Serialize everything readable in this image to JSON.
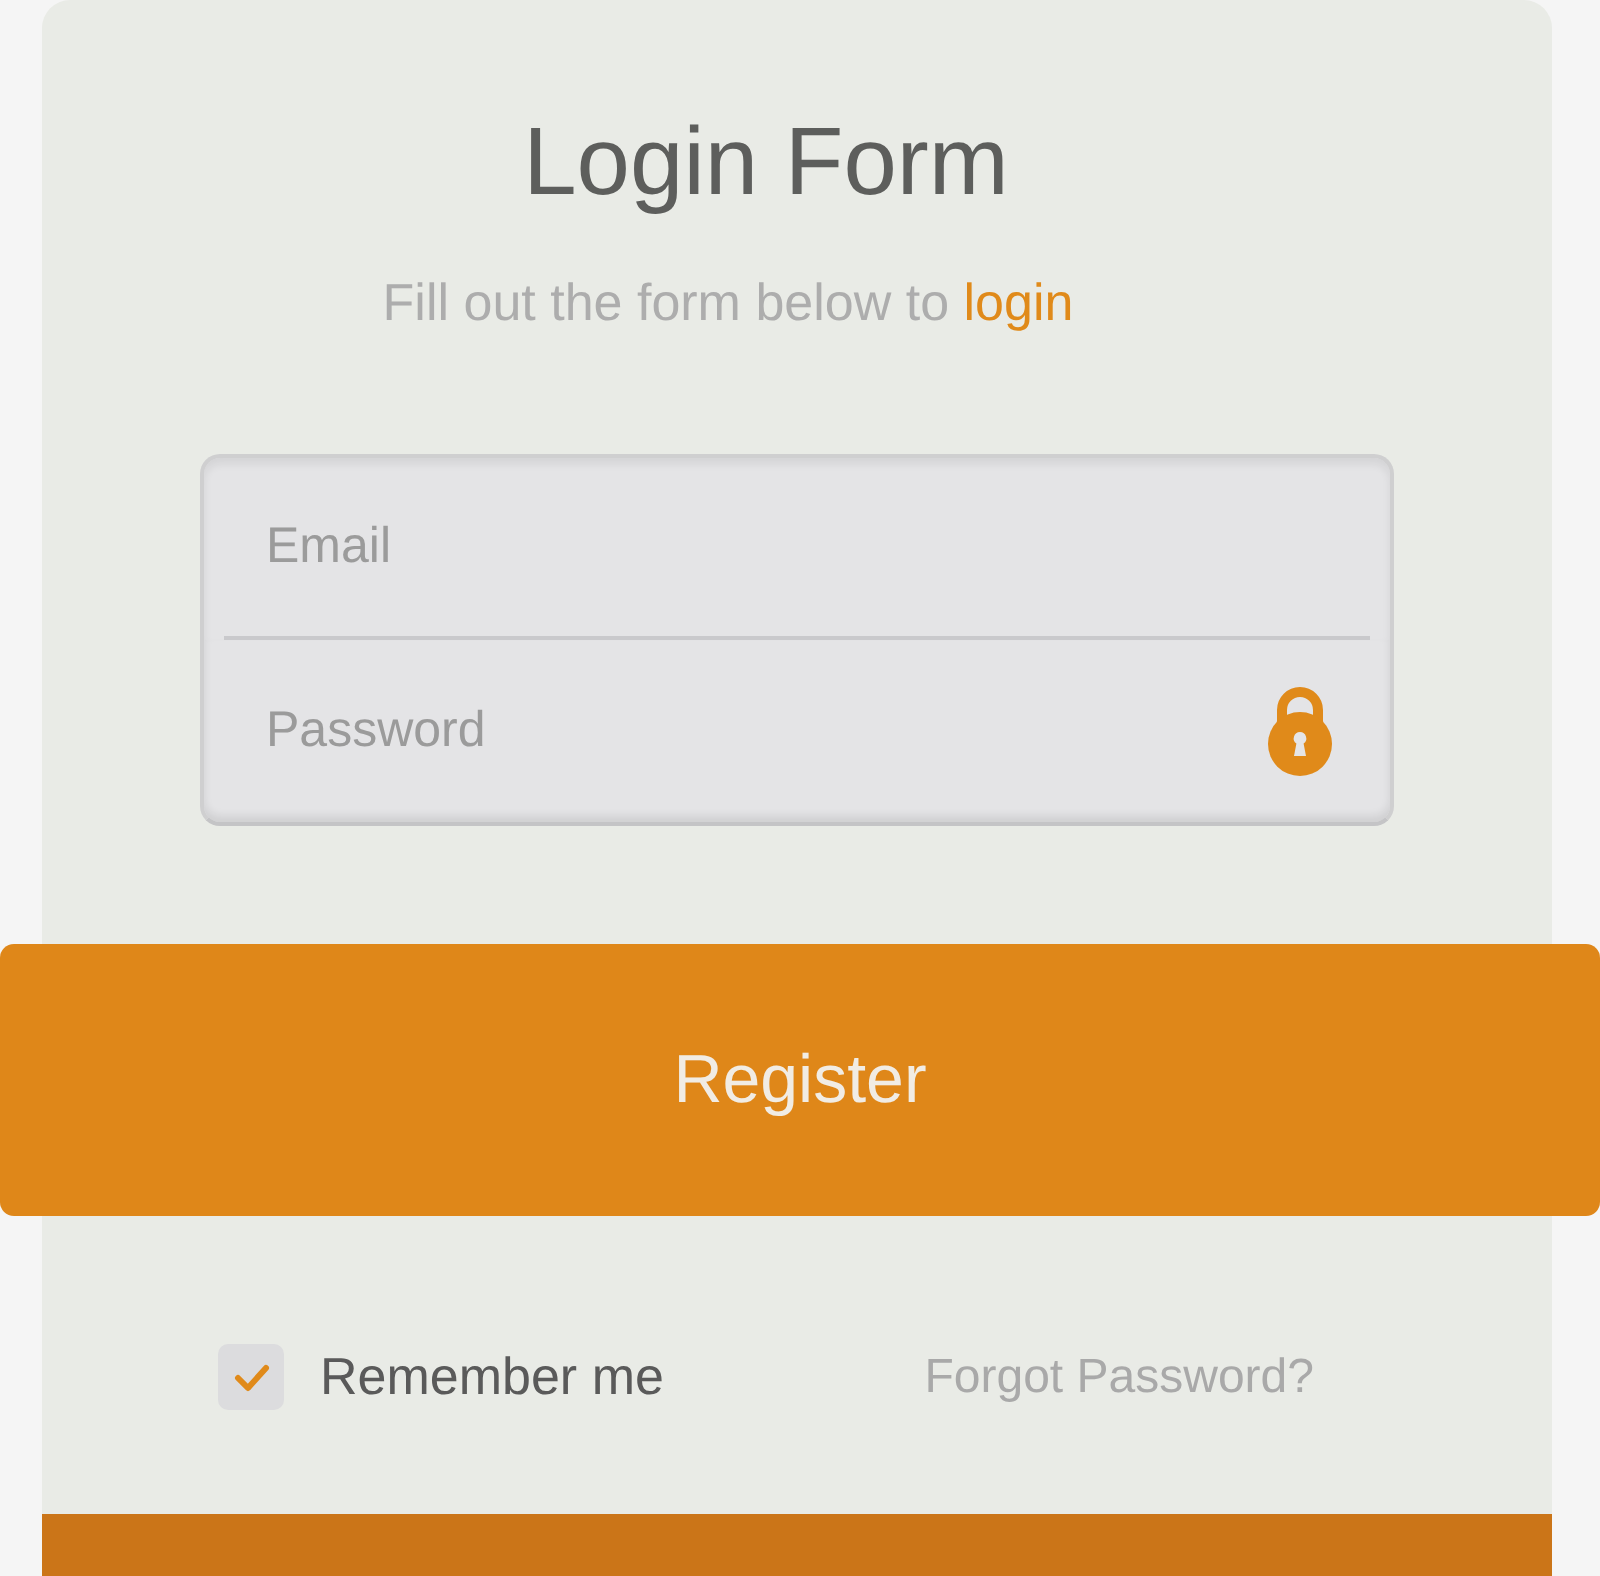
{
  "title": "Login Form",
  "subtitle": {
    "text": "Fill out the form below to",
    "link": "login"
  },
  "fields": [
    {
      "kind": "email",
      "placeholder": "Email"
    },
    {
      "kind": "password",
      "placeholder": "Password"
    }
  ],
  "register_button": "Register",
  "remember_me": {
    "label": "Remember me",
    "checked": true
  },
  "forgot_link": "Forgot Password?"
}
